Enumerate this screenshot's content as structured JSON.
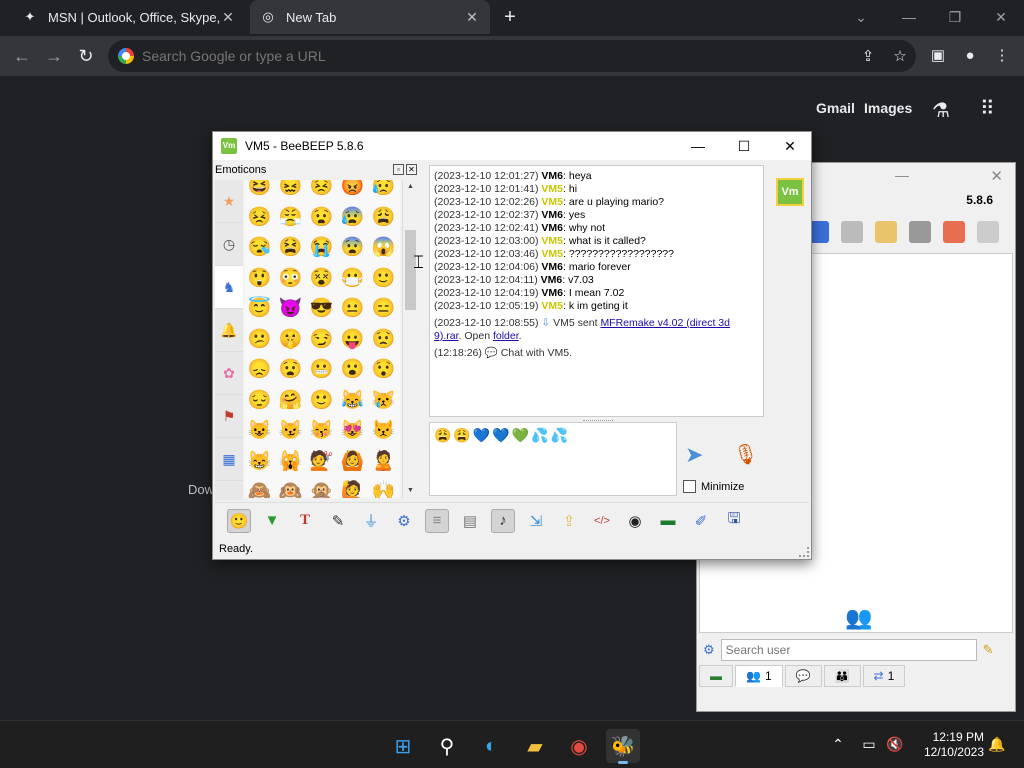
{
  "browser": {
    "tabs": [
      {
        "title": "MSN | Outlook, Office, Skype, Bi",
        "active": false
      },
      {
        "title": "New Tab",
        "active": true
      }
    ],
    "omnibox_placeholder": "Search Google or type a URL",
    "ntp_links": [
      "Gmail",
      "Images"
    ],
    "ntp_partial_text": "Dow"
  },
  "chat_window": {
    "title": "VM5 - BeeBEEP 5.8.6",
    "app_icon_text": "Vm",
    "emoticons_panel": {
      "title": "Emoticons",
      "categories": [
        "star-icon",
        "clock-icon",
        "person-icon",
        "bell-icon",
        "flower-icon",
        "flag-icon",
        "symbols-icon"
      ],
      "selected_category": 2,
      "grid": [
        "😆",
        "😖",
        "😣",
        "😡",
        "😥",
        "😣",
        "😤",
        "😧",
        "😰",
        "😩",
        "😪",
        "😫",
        "😭",
        "😨",
        "😱",
        "😲",
        "😳",
        "😵",
        "😷",
        "🙂",
        "😇",
        "😈",
        "😎",
        "😐",
        "😑",
        "😕",
        "🤫",
        "😏",
        "😛",
        "😟",
        "😞",
        "😧",
        "😬",
        "😮",
        "😯",
        "😔",
        "🤗",
        "🙂",
        "😹",
        "😿",
        "😺",
        "😼",
        "😽",
        "😻",
        "😾",
        "😸",
        "🙀",
        "💇",
        "🙆",
        "🙎",
        "🙈",
        "🙉",
        "🙊",
        "🙋",
        "🙌",
        "👶",
        "👧",
        "🙏",
        "👊",
        "✋"
      ]
    },
    "messages": [
      {
        "ts": "(2023-12-10 12:01:27)",
        "user": "VM6",
        "text": "heya"
      },
      {
        "ts": "(2023-12-10 12:01:41)",
        "user": "VM5",
        "text": "hi"
      },
      {
        "ts": "(2023-12-10 12:02:26)",
        "user": "VM5",
        "text": "are u playing mario?"
      },
      {
        "ts": "(2023-12-10 12:02:37)",
        "user": "VM6",
        "text": "yes"
      },
      {
        "ts": "(2023-12-10 12:02:41)",
        "user": "VM6",
        "text": "why not"
      },
      {
        "ts": "(2023-12-10 12:03:00)",
        "user": "VM5",
        "text": "what is it called?"
      },
      {
        "ts": "(2023-12-10 12:03:46)",
        "user": "VM5",
        "text": "??????????????????"
      },
      {
        "ts": "(2023-12-10 12:04:06)",
        "user": "VM6",
        "text": "mario forever"
      },
      {
        "ts": "(2023-12-10 12:04:11)",
        "user": "VM6",
        "text": "v7.03"
      },
      {
        "ts": "(2023-12-10 12:04:19)",
        "user": "VM6",
        "text": "I mean 7.02"
      },
      {
        "ts": "(2023-12-10 12:05:19)",
        "user": "VM5",
        "text": "k im geting it"
      }
    ],
    "file_event": {
      "ts": "(2023-12-10 12:08:55)",
      "text_before": "VM5 sent",
      "file_name_line1": "MFRemake v4.02 (direct 3d",
      "file_name_line2": "9).rar",
      "open_text": ". Open",
      "folder_link": "folder",
      "end": "."
    },
    "chat_event": {
      "ts": "(12:18:26)",
      "text": "Chat with VM5."
    },
    "compose_text": "😩😩💙💙💚💦💦",
    "minimize_label": "Minimize",
    "minimize_checked": false,
    "toolbar_icons": [
      "emoticon-icon",
      "download-icon",
      "font-icon",
      "color-picker-icon",
      "filter-icon",
      "settings-icon",
      "spellcheck-icon",
      "abbreviation-icon",
      "note-icon",
      "save-chat-icon",
      "send-file-icon",
      "html-icon",
      "screenshot-icon",
      "record-icon",
      "edit-icon",
      "save-icon"
    ],
    "status": "Ready.",
    "user_badge": "Vm"
  },
  "beebeep_main": {
    "version": "5.8.6",
    "search_placeholder": "Search user",
    "tabs": [
      {
        "icon": "users-icon",
        "count": "1"
      },
      {
        "icon": "chat-icon",
        "count": ""
      },
      {
        "icon": "group-icon",
        "count": ""
      },
      {
        "icon": "share-icon",
        "count": "1"
      }
    ]
  },
  "taskbar": {
    "time": "12:19 PM",
    "date": "12/10/2023",
    "apps": [
      "windows-start-icon",
      "search-icon",
      "edge-icon",
      "file-explorer-icon",
      "chrome-icon",
      "beebeep-icon"
    ]
  }
}
